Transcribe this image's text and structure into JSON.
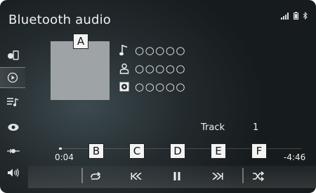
{
  "header": {
    "title": "Bluetooth audio"
  },
  "status_icons": [
    "signal-icon",
    "battery-icon",
    "bluetooth-icon"
  ],
  "sidebar": {
    "items": [
      {
        "name": "phone-source-icon"
      },
      {
        "name": "play-circle-icon",
        "active": true
      },
      {
        "name": "playlist-icon"
      },
      {
        "name": "eye-icon"
      },
      {
        "name": "connection-icon"
      },
      {
        "name": "volume-icon"
      }
    ]
  },
  "album": {
    "callout": "A"
  },
  "track_info": {
    "song": "○○○○○",
    "artist": "○○○○○",
    "album": "○○○○○"
  },
  "track": {
    "label": "Track",
    "number": "1"
  },
  "progress": {
    "elapsed": "0:04",
    "remaining": "-4:46",
    "fraction": 0.013
  },
  "controls": {
    "repeat": {
      "callout": "B"
    },
    "previous": {
      "callout": "C"
    },
    "pause": {
      "callout": "D"
    },
    "next": {
      "callout": "E"
    },
    "shuffle": {
      "callout": "F"
    }
  },
  "colors": {
    "background": "#232a2d",
    "album_art": "#9ea3a6",
    "text": "#f1f1f1"
  }
}
